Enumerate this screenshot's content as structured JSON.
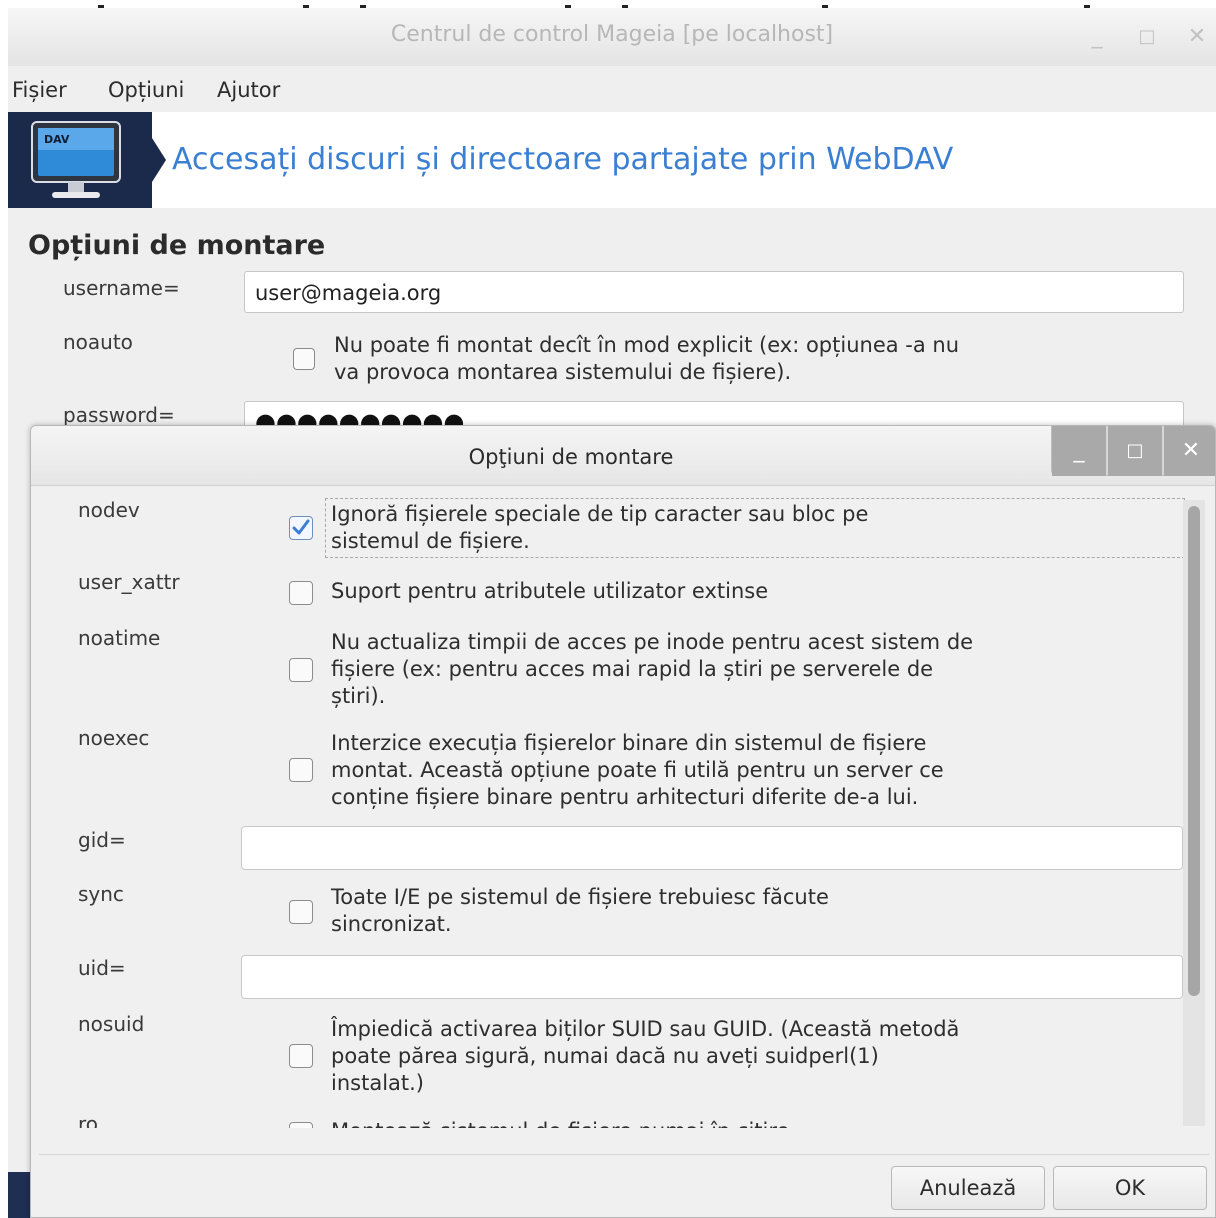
{
  "main_window": {
    "title": "Centrul de control Mageia  [pe localhost]",
    "controls": {
      "minimize": "_",
      "maximize": "□",
      "close": "✕"
    },
    "menu": [
      "Fișier",
      "Opțiuni",
      "Ajutor"
    ],
    "banner": {
      "icon_label": "DAV",
      "title": "Accesați discuri și directoare partajate prin WebDAV"
    },
    "section_title": "Opțiuni de montare",
    "fields": {
      "username_label": "username=",
      "username_value": "user@mageia.org",
      "noauto_label": "noauto",
      "noauto_text_1": "Nu poate fi montat decît în mod explicit (ex: opțiunea -a nu",
      "noauto_text_2": "va provoca montarea sistemului de fișiere).",
      "noauto_checked": false,
      "password_label": "password=",
      "password_mask": "●●●●●●●●●●"
    }
  },
  "dialog": {
    "title": "Opţiuni de montare",
    "controls": {
      "minimize": "_",
      "maximize": "□",
      "close": "✕"
    },
    "options": [
      {
        "label": "nodev",
        "checked": true,
        "lines": [
          "Ignoră fișierele speciale de tip caracter sau bloc pe",
          "sistemul de fișiere."
        ]
      },
      {
        "label": "user_xattr",
        "checked": false,
        "lines": [
          "Suport pentru atributele utilizator extinse"
        ]
      },
      {
        "label": "noatime",
        "checked": false,
        "lines": [
          "Nu actualiza timpii de acces pe inode pentru acest sistem de",
          "fișiere (ex: pentru acces mai rapid la știri pe serverele de",
          "știri)."
        ]
      },
      {
        "label": "noexec",
        "checked": false,
        "lines": [
          "Interzice execuția fișierelor binare din sistemul de fișiere",
          "montat. Această opțiune poate fi utilă pentru un server ce",
          "conține fișiere binare pentru arhitecturi diferite de-a lui."
        ]
      },
      {
        "label": "gid=",
        "value": ""
      },
      {
        "label": "sync",
        "checked": false,
        "lines": [
          "Toate I/E pe sistemul de fișiere trebuiesc făcute",
          "sincronizat."
        ]
      },
      {
        "label": "uid=",
        "value": ""
      },
      {
        "label": "nosuid",
        "checked": false,
        "lines": [
          "Împiedică activarea biților SUID sau GUID. (Această metodă",
          "poate părea sigură, numai dacă nu aveți suidperl(1)",
          "instalat.)"
        ]
      },
      {
        "label": "ro",
        "checked": false,
        "lines": [
          "Montează sistemul de fișiere numai în citire."
        ]
      }
    ],
    "buttons": {
      "cancel": "Anulează",
      "ok": "OK"
    }
  },
  "colors": {
    "accent": "#3b7fd3",
    "banner_bg": "#1b2a4b",
    "check_mark": "#3b7fd3"
  }
}
